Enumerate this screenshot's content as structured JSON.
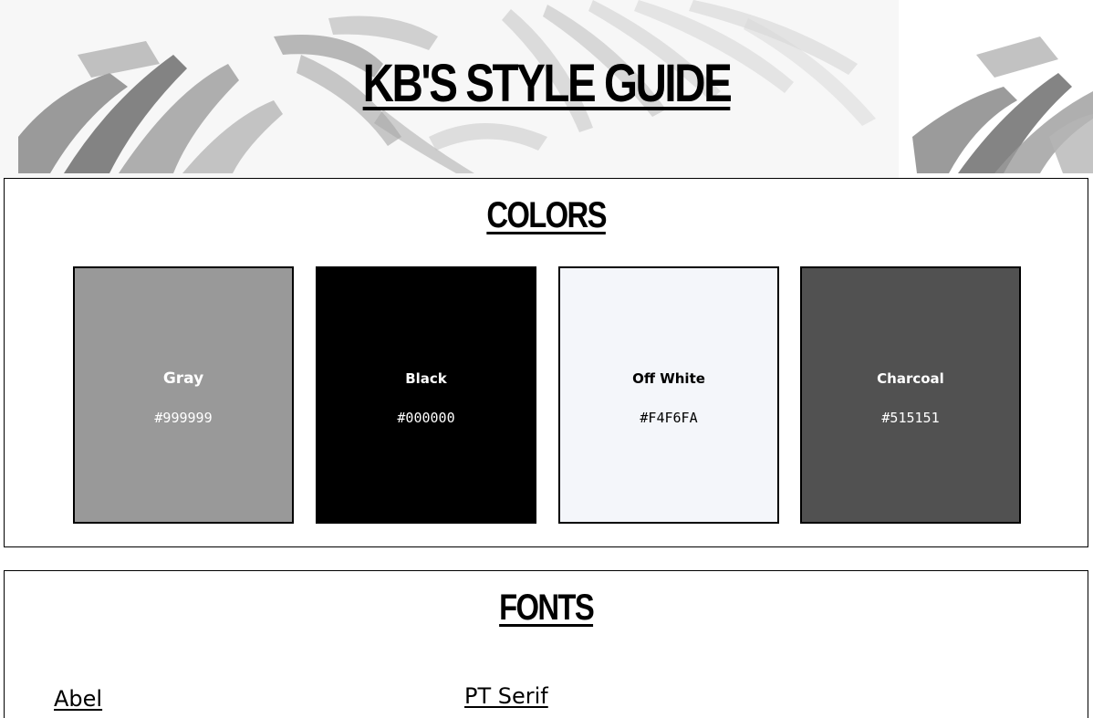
{
  "header": {
    "title": "KB'S STYLE GUIDE"
  },
  "colors": {
    "heading": "COLORS",
    "swatches": [
      {
        "name": "Gray",
        "hex": "#999999",
        "text_color": "#FFFFFF"
      },
      {
        "name": "Black",
        "hex": "#000000",
        "text_color": "#FFFFFF"
      },
      {
        "name": "Off White",
        "hex": "#F4F6FA",
        "text_color": "#000000"
      },
      {
        "name": "Charcoal",
        "hex": "#515151",
        "text_color": "#FFFFFF"
      }
    ]
  },
  "fonts": {
    "heading": "FONTS",
    "items": [
      {
        "label": "Abel"
      },
      {
        "label": "PT Serif"
      }
    ]
  },
  "icons": {
    "banner_background": "brush-stroke-pattern"
  }
}
